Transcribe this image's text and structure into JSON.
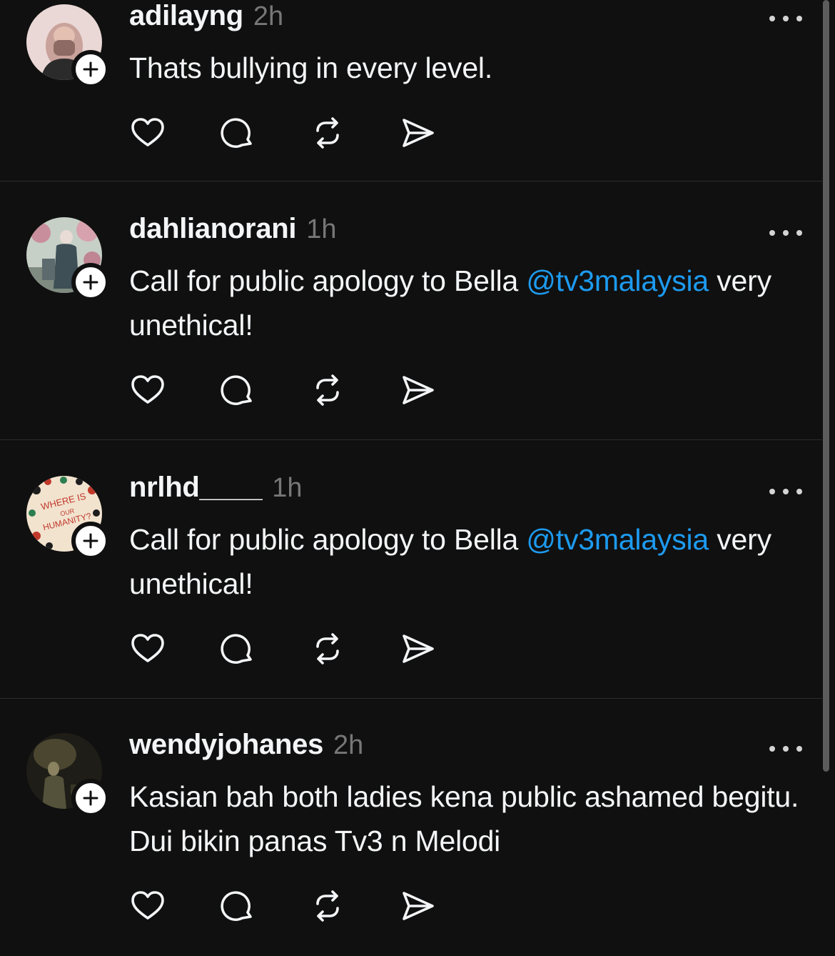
{
  "posts": [
    {
      "username": "adilayng",
      "time": "2h",
      "text_before": "Thats bullying in every level.",
      "mention": "",
      "text_after": "",
      "avatar": "woman-in-hijab-photo"
    },
    {
      "username": "dahlianorani",
      "time": "1h",
      "text_before": "Call for public apology to Bella ",
      "mention": "@tv3malaysia",
      "text_after": " very unethical!",
      "avatar": "woman-in-garden-photo"
    },
    {
      "username": "nrlhd____",
      "time": "1h",
      "text_before": "Call for public apology to Bella ",
      "mention": "@tv3malaysia",
      "text_after": " very unethical!",
      "avatar": "where-is-our-humanity-illustration"
    },
    {
      "username": "wendyjohanes",
      "time": "2h",
      "text_before": "Kasian bah both ladies kena public ashamed begitu. Dui bikin panas Tv3 n Melodi",
      "mention": "",
      "text_after": "",
      "avatar": "dim-concert-photo"
    }
  ],
  "avatar_badge_text": {
    "line1": "WHERE IS",
    "line2": "OUR",
    "line3": "HUMANITY?"
  },
  "icons": {
    "like": "heart-icon",
    "reply": "comment-icon",
    "repost": "repost-icon",
    "share": "send-icon",
    "more": "more-dots-icon",
    "follow": "plus-icon"
  },
  "colors": {
    "background": "#101010",
    "text": "#f3f5f7",
    "muted": "#777777",
    "mention": "#1d9bf0",
    "divider": "#2c2c2c"
  }
}
